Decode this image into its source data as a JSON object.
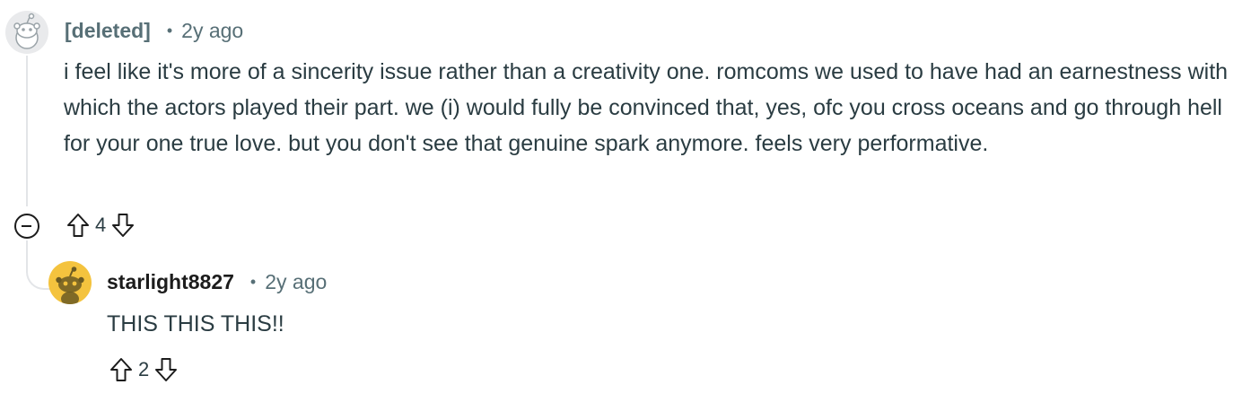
{
  "comments": [
    {
      "author": "[deleted]",
      "time": "2y ago",
      "body": "i feel like it's more of a sincerity issue rather than a creativity one. romcoms we used to have had an earnestness with which the actors played their part. we (i) would fully be convinced that, yes, ofc you cross oceans and go through hell for your one true love. but you don't see that genuine spark anymore. feels very performative.",
      "score": "4"
    },
    {
      "author": "starlight8827",
      "time": "2y ago",
      "body": "THIS THIS THIS!!",
      "score": "2"
    }
  ],
  "separator": "•",
  "icons": {
    "avatar_deleted": "snoo-avatar-grey",
    "avatar_reply": "snoo-avatar-yellow",
    "collapse": "collapse-minus-icon",
    "upvote": "upvote-arrow-icon",
    "downvote": "downvote-arrow-icon"
  },
  "colors": {
    "meta_text": "#576f76",
    "body_text": "#2a3c42",
    "thread_line": "#e3e5e8",
    "reply_avatar_bg": "#f4c33e"
  }
}
